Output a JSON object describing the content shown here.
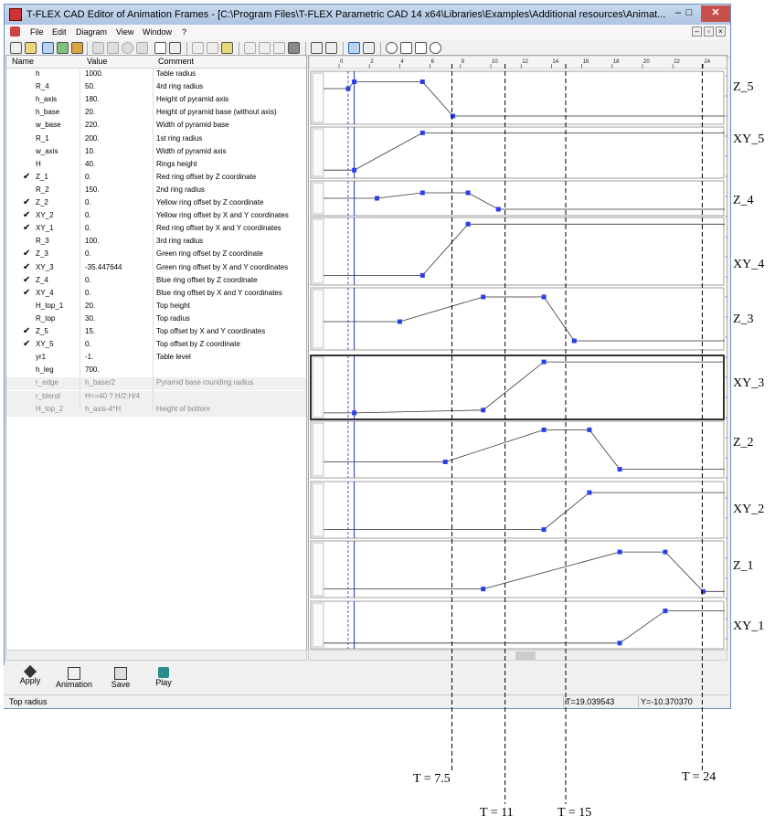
{
  "window": {
    "title": "T-FLEX CAD Editor of Animation Frames - [C:\\Program Files\\T-FLEX Parametric CAD 14 x64\\Libraries\\Examples\\Additional resources\\Animat...",
    "min": "–",
    "max": "□",
    "close": "✕"
  },
  "menu": [
    "File",
    "Edit",
    "Diagram",
    "View",
    "Window",
    "?"
  ],
  "table": {
    "headers": [
      "Name",
      "Value",
      "Comment"
    ],
    "rows": [
      {
        "check": "",
        "name": "h",
        "value": "1000.",
        "comment": "Table radius"
      },
      {
        "check": "",
        "name": "R_4",
        "value": "50.",
        "comment": "4rd ring radius"
      },
      {
        "check": "",
        "name": "h_axis",
        "value": "180.",
        "comment": "Height of pyramid axis"
      },
      {
        "check": "",
        "name": "h_base",
        "value": "20.",
        "comment": "Height of pyramid base (without axis)"
      },
      {
        "check": "",
        "name": "w_base",
        "value": "220.",
        "comment": "Width of pyramid base"
      },
      {
        "check": "",
        "name": "R_1",
        "value": "200.",
        "comment": "1st ring radius"
      },
      {
        "check": "",
        "name": "w_axis",
        "value": "10.",
        "comment": "Width of pyramid axis"
      },
      {
        "check": "",
        "name": "H",
        "value": "40.",
        "comment": "Rings height"
      },
      {
        "check": "✔",
        "name": "Z_1",
        "value": "0.",
        "comment": "Red ring offset by Z coordinate"
      },
      {
        "check": "",
        "name": "R_2",
        "value": "150.",
        "comment": "2nd ring radius"
      },
      {
        "check": "✔",
        "name": "Z_2",
        "value": "0.",
        "comment": "Yellow ring offset by Z coordinate"
      },
      {
        "check": "✔",
        "name": "XY_2",
        "value": "0.",
        "comment": "Yellow ring offset by X and Y coordinates"
      },
      {
        "check": "✔",
        "name": "XY_1",
        "value": "0.",
        "comment": "Red ring offset by X and Y coordinates"
      },
      {
        "check": "",
        "name": "R_3",
        "value": "100.",
        "comment": "3rd ring radius"
      },
      {
        "check": "✔",
        "name": "Z_3",
        "value": "0.",
        "comment": "Green ring offset by Z coordinate"
      },
      {
        "check": "✔",
        "name": "XY_3",
        "value": "-35.447644",
        "comment": "Green ring offset by X and Y coordinates"
      },
      {
        "check": "✔",
        "name": "Z_4",
        "value": "0.",
        "comment": "Blue ring offset by Z coordinate"
      },
      {
        "check": "✔",
        "name": "XY_4",
        "value": "0.",
        "comment": "Blue ring offset by X and Y coordinates"
      },
      {
        "check": "",
        "name": "H_top_1",
        "value": "20.",
        "comment": "Top height"
      },
      {
        "check": "",
        "name": "R_top",
        "value": "30.",
        "comment": "Top radius"
      },
      {
        "check": "✔",
        "name": "Z_5",
        "value": "15.",
        "comment": "Top offset by X and Y coordinates"
      },
      {
        "check": "✔",
        "name": "XY_5",
        "value": "0.",
        "comment": "Top offset by Z coordinate"
      },
      {
        "check": "",
        "name": "yr1",
        "value": "-1.",
        "comment": "Table level"
      },
      {
        "check": "",
        "name": "h_leg",
        "value": "700.",
        "comment": ""
      },
      {
        "check": "",
        "name": "r_edge",
        "value": "h_base/2",
        "comment": "Pyramid base rounding radius",
        "grey": true
      },
      {
        "check": "",
        "name": "r_blend",
        "value": "H<=40 ? H/2:H/4",
        "comment": "",
        "grey": true
      },
      {
        "check": "",
        "name": "H_top_2",
        "value": "h_axis-4*H",
        "comment": "Height of bottom",
        "grey": true
      }
    ]
  },
  "ruler_ticks": [
    "0",
    "2",
    "4",
    "6",
    "8",
    "10",
    "12",
    "14",
    "16",
    "18",
    "20",
    "22",
    "24"
  ],
  "tracks": [
    {
      "label": "Z_5",
      "points": [
        [
          0.6,
          0.7
        ],
        [
          1,
          0.85
        ],
        [
          5.5,
          0.85
        ],
        [
          7.5,
          0.1
        ]
      ]
    },
    {
      "label": "XY_5",
      "points": [
        [
          1,
          0.1
        ],
        [
          5.5,
          0.95
        ]
      ]
    },
    {
      "label": "Z_4",
      "points": [
        [
          2.5,
          0.5
        ],
        [
          5.5,
          0.7
        ],
        [
          8.5,
          0.7
        ],
        [
          10.5,
          0.1
        ]
      ]
    },
    {
      "label": "XY_4",
      "points": [
        [
          5.5,
          0.1
        ],
        [
          8.5,
          0.95
        ]
      ]
    },
    {
      "label": "Z_3",
      "points": [
        [
          4,
          0.45
        ],
        [
          9.5,
          0.9
        ],
        [
          13.5,
          0.9
        ],
        [
          15.5,
          0.1
        ]
      ]
    },
    {
      "label": "XY_3",
      "points": [
        [
          1,
          0.05
        ],
        [
          9.5,
          0.1
        ],
        [
          13.5,
          0.95
        ]
      ]
    },
    {
      "label": "Z_2",
      "points": [
        [
          7,
          0.25
        ],
        [
          13.5,
          0.9
        ],
        [
          16.5,
          0.9
        ],
        [
          18.5,
          0.1
        ]
      ]
    },
    {
      "label": "XY_2",
      "points": [
        [
          13.5,
          0.1
        ],
        [
          16.5,
          0.85
        ]
      ]
    },
    {
      "label": "Z_1",
      "points": [
        [
          9.5,
          0.1
        ],
        [
          18.5,
          0.85
        ],
        [
          21.5,
          0.85
        ],
        [
          24,
          0.05
        ]
      ]
    },
    {
      "label": "XY_1",
      "points": [
        [
          18.5,
          0.05
        ],
        [
          21.5,
          0.85
        ]
      ]
    }
  ],
  "bottom_buttons": [
    "Apply",
    "Animation",
    "Save",
    "Play"
  ],
  "status": {
    "text": "Top radius",
    "t": "T=19.039543",
    "y": "Y=-10.370370"
  },
  "markers": [
    {
      "label": "T = 7.5",
      "t": 7.5
    },
    {
      "label": "T = 11",
      "t": 11
    },
    {
      "label": "T = 15",
      "t": 15
    },
    {
      "label": "T = 24",
      "t": 24
    }
  ]
}
